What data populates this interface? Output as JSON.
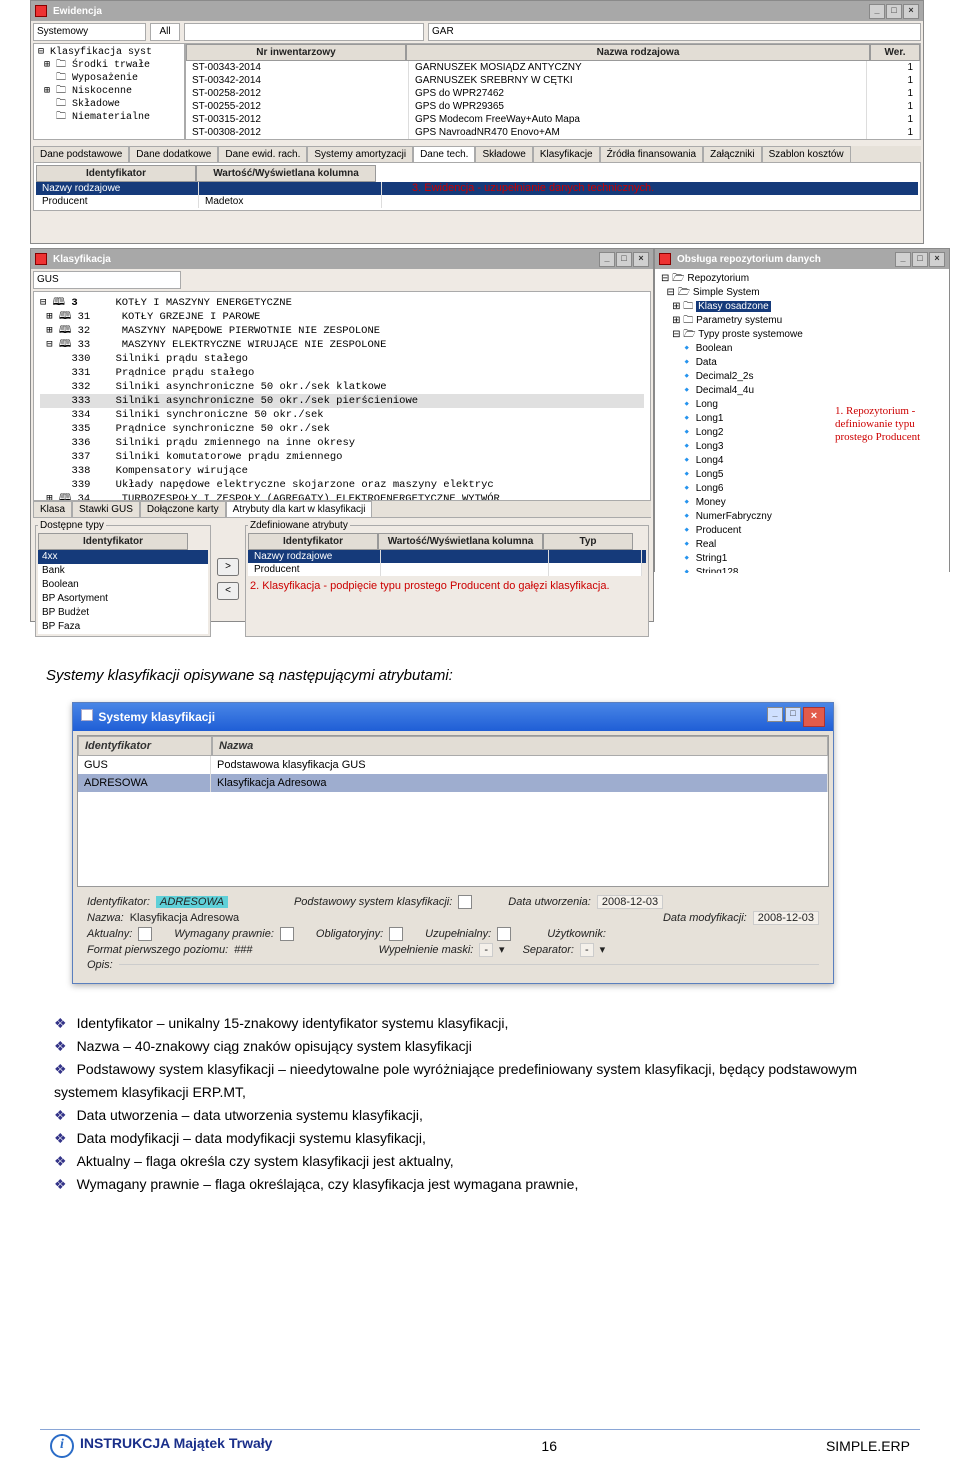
{
  "ewidencja": {
    "title": "Ewidencja",
    "filter1": "Systemowy",
    "filter1_sub": "All",
    "filter2": "GAR",
    "tree": [
      "Klasyfikacja syst",
      "Środki trwałe",
      "Wyposażenie",
      "Niskocenne",
      "Składowe",
      "Niematerialne"
    ],
    "cols": {
      "c1": "Nr inwentarzowy",
      "c2": "Nazwa rodzajowa",
      "c3": "Wer."
    },
    "rows": [
      {
        "nr": "ST-00343-2014",
        "nazwa": "GARNUSZEK MOSIĄDZ ANTYCZNY",
        "w": "1"
      },
      {
        "nr": "ST-00342-2014",
        "nazwa": "GARNUSZEK SREBRNY W CĘTKI",
        "w": "1"
      },
      {
        "nr": "ST-00258-2012",
        "nazwa": "GPS do WPR27462",
        "w": "1"
      },
      {
        "nr": "ST-00255-2012",
        "nazwa": "GPS do WPR29365",
        "w": "1"
      },
      {
        "nr": "ST-00315-2012",
        "nazwa": "GPS Modecom FreeWay+Auto Mapa",
        "w": "1"
      },
      {
        "nr": "ST-00308-2012",
        "nazwa": "GPS NavroadNR470 Enovo+AM",
        "w": "1"
      }
    ],
    "tabs": [
      "Dane podstawowe",
      "Dane dodatkowe",
      "Dane ewid. rach.",
      "Systemy amortyzacji",
      "Dane tech.",
      "Składowe",
      "Klasyfikacje",
      "Źródła finansowania",
      "Załączniki",
      "Szablon kosztów"
    ],
    "tab_active": 4,
    "subcols": {
      "id": "Identyfikator",
      "val": "Wartość/Wyświetlana kolumna"
    },
    "subrow1": {
      "id": "Nazwy rodzajowe",
      "val": ""
    },
    "subrow2": {
      "id": "Producent",
      "val": "Madetox"
    },
    "note": "3. Ewidencja - uzupełnianie danych technicznych."
  },
  "klas": {
    "title": "Klasyfikacja",
    "filter": "GUS",
    "tree": [
      {
        "c": "3",
        "n": "KOTŁY I MASZYNY ENERGETYCZNE"
      },
      {
        "c": "31",
        "n": "KOTŁY GRZEJNE I PAROWE"
      },
      {
        "c": "32",
        "n": "MASZYNY NAPĘDOWE PIERWOTNIE NIE ZESPOLONE"
      },
      {
        "c": "33",
        "n": "MASZYNY ELEKTRYCZNE WIRUJĄCE NIE ZESPOLONE"
      },
      {
        "c": "330",
        "n": "Silniki prądu stałego"
      },
      {
        "c": "331",
        "n": "Prądnice prądu stałego"
      },
      {
        "c": "332",
        "n": "Silniki asynchroniczne 50 okr./sek klatkowe"
      },
      {
        "c": "333",
        "n": "Silniki asynchroniczne 50 okr./sek pierścieniowe"
      },
      {
        "c": "334",
        "n": "Silniki synchroniczne 50 okr./sek"
      },
      {
        "c": "335",
        "n": "Prądnice synchroniczne 50 okr./sek"
      },
      {
        "c": "336",
        "n": "Silniki prądu zmiennego na inne okresy"
      },
      {
        "c": "337",
        "n": "Silniki komutatorowe prądu zmiennego"
      },
      {
        "c": "338",
        "n": "Kompensatory wirujące"
      },
      {
        "c": "339",
        "n": "Układy napędowe elektryczne skojarzone oraz maszyny elektryc"
      },
      {
        "c": "34",
        "n": "TURBOZESPOŁY I ZESPOŁY (AGREGATY) ELEKTROENERGETYCZNE WYTWÓR"
      }
    ],
    "tabs2": [
      "Klasa",
      "Stawki GUS",
      "Dołączone karty",
      "Atrybuty dla kart w klasyfikacji"
    ],
    "tab2_active": 3,
    "left_panel_title": "Dostępne typy",
    "left_col": "Identyfikator",
    "left_items": [
      "4xx",
      "Bank",
      "Boolean",
      "BP Asortyment",
      "BP Budżet",
      "BP Faza"
    ],
    "right_panel_title": "Zdefiniowane atrybuty",
    "right_cols": {
      "id": "Identyfikator",
      "val": "Wartość/Wyświetlana kolumna",
      "typ": "Typ"
    },
    "right_rows": [
      {
        "id": "Nazwy rodzajowe",
        "val": "",
        "typ": ""
      },
      {
        "id": "Producent",
        "val": "",
        "typ": ""
      }
    ],
    "note": "2. Klasyfikacja - podpięcie typu prostego Producent do gałęzi klasyfikacja.",
    "btn_right": ">",
    "btn_left": "<"
  },
  "repo": {
    "title": "Obsługa repozytorium danych",
    "tree_top": [
      "Repozytorium",
      "Simple System"
    ],
    "tree_sel": "Klasy osadzone",
    "tree_mid": [
      "Parametry systemu",
      "Typy proste systemowe"
    ],
    "items": [
      "Boolean",
      "Data",
      "Decimal2_2s",
      "Decimal4_4u",
      "Long",
      "Long1",
      "Long2",
      "Long3",
      "Long4",
      "Long5",
      "Long6",
      "Money",
      "NumerFabryczny",
      "Producent",
      "Real",
      "String1",
      "String128"
    ],
    "note": "1. Repozytorium - definiowanie typu prostego Producent"
  },
  "intro": "Systemy klasyfikacji opisywane są następującymi atrybutami:",
  "modal": {
    "title": "Systemy klasyfikacji",
    "cols": {
      "id": "Identyfikator",
      "nz": "Nazwa"
    },
    "rows": [
      {
        "id": "GUS",
        "nz": "Podstawowa klasyfikacja GUS"
      },
      {
        "id": "ADRESOWA",
        "nz": "Klasyfikacja Adresowa"
      }
    ],
    "labels": {
      "ident": "Identyfikator:",
      "ident_val": "ADRESOWA",
      "podst": "Podstawowy system klasyfikacji:",
      "dutw": "Data utworzenia:",
      "dutw_val": "2008-12-03",
      "nazwa": "Nazwa:",
      "nazwa_val": "Klasyfikacja Adresowa",
      "dmod": "Data modyfikacji:",
      "dmod_val": "2008-12-03",
      "akt": "Aktualny:",
      "wym": "Wymagany prawnie:",
      "obl": "Obligatoryjny:",
      "uzup": "Uzupełnialny:",
      "uzytk": "Użytkownik:",
      "fmt": "Format pierwszego poziomu:",
      "fmt_val": "###",
      "wypmask": "Wypełnienie maski:",
      "sep": "Separator:",
      "dash": "-",
      "opis": "Opis:"
    }
  },
  "attrs": [
    {
      "n": "Identyfikator",
      "d": " – unikalny 15-znakowy identyfikator systemu klasyfikacji,"
    },
    {
      "n": "Nazwa",
      "d": " – 40-znakowy ciąg znaków opisujący system klasyfikacji"
    },
    {
      "n": "Podstawowy system klasyfikacji",
      "d": " – nieedytowalne pole wyróżniające predefiniowany system klasyfikacji, będący podstawowym systemem klasyfikacji  ERP.MT,"
    },
    {
      "n": "Data utworzenia",
      "d": " – data utworzenia systemu klasyfikacji,"
    },
    {
      "n": "Data modyfikacji",
      "d": " – data modyfikacji systemu klasyfikacji,"
    },
    {
      "n": "Aktualny",
      "d": " – flaga określa czy system klasyfikacji jest aktualny,"
    },
    {
      "n": "",
      "d": "Wymagany prawnie – flaga określająca, czy klasyfikacja jest wymagana prawnie,"
    }
  ],
  "footer": {
    "left": "INSTRUKCJA Majątek Trwały",
    "page": "16",
    "right": "SIMPLE.ERP"
  }
}
